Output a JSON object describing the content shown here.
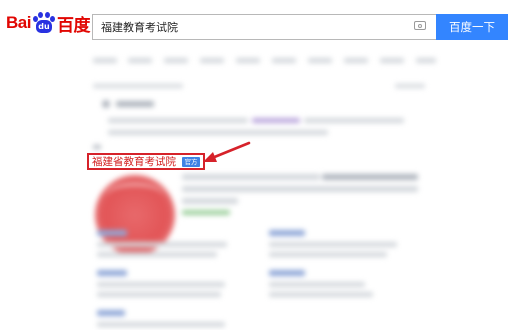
{
  "logo": {
    "part1": "Bai",
    "paw_text": "du",
    "part2": "百度"
  },
  "search": {
    "query": "福建教育考试院",
    "button_label": "百度一下"
  },
  "result": {
    "title": "福建省教育考试院",
    "official_badge": "官方"
  },
  "colors": {
    "accent": "#3385ff",
    "brand_red": "#e10602",
    "highlight_red": "#d6222a"
  },
  "icons": [
    "camera-icon",
    "baidu-paw-logo"
  ]
}
